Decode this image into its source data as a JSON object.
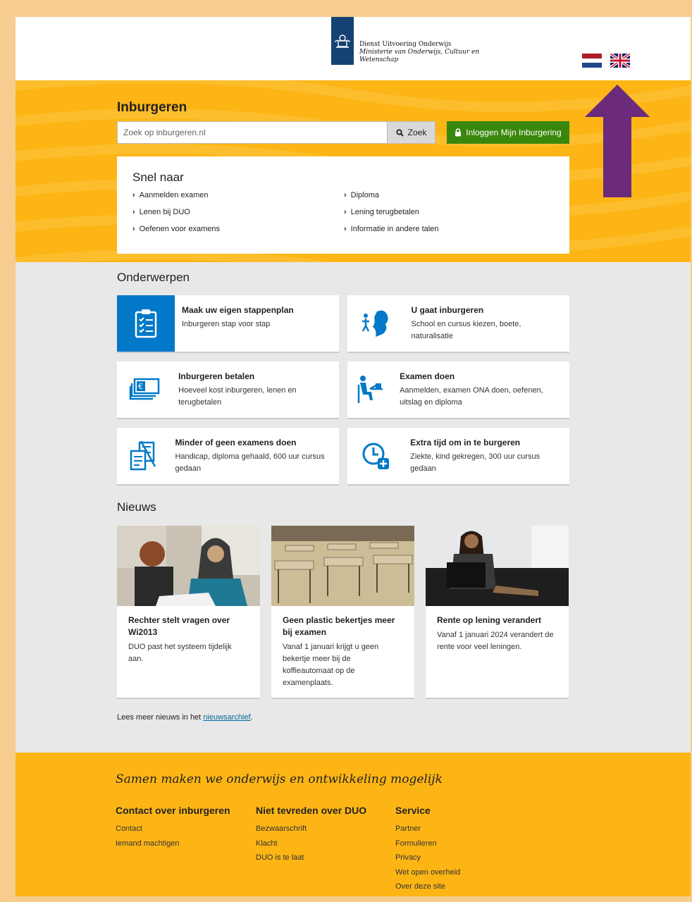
{
  "header": {
    "org_line1": "Dienst Uitvoering Onderwijs",
    "org_line2": "Ministerie van Onderwijs, Cultuur en",
    "org_line3": "Wetenschap"
  },
  "hero": {
    "title": "Inburgeren",
    "search_placeholder": "Zoek op inburgeren.nl",
    "search_button": "Zoek",
    "login_button": "Inloggen Mijn Inburgering"
  },
  "quick": {
    "title": "Snel naar",
    "items": [
      "Aanmelden examen",
      "Diploma",
      "Lenen bij DUO",
      "Lening terugbetalen",
      "Oefenen voor examens",
      "Informatie in andere talen"
    ]
  },
  "topics": {
    "title": "Onderwerpen",
    "cards": [
      {
        "title": "Maak uw eigen stappenplan",
        "desc": "Inburgeren stap voor stap",
        "icon": "clipboard-checklist-icon"
      },
      {
        "title": "U gaat inburgeren",
        "desc": "School en cursus kiezen, boete, naturalisatie",
        "icon": "netherlands-map-walker-icon"
      },
      {
        "title": "Inburgeren betalen",
        "desc": "Hoeveel kost inburgeren, lenen en terugbetalen",
        "icon": "euro-banknotes-icon"
      },
      {
        "title": "Examen doen",
        "desc": "Aanmelden, examen ONA doen, oefenen, uitslag en diploma",
        "icon": "person-at-desk-icon"
      },
      {
        "title": "Minder of geen examens doen",
        "desc": "Handicap, diploma gehaald, 600 uur cursus gedaan",
        "icon": "crossed-documents-icon"
      },
      {
        "title": "Extra tijd om in te burgeren",
        "desc": "Ziekte, kind gekregen, 300 uur cursus gedaan",
        "icon": "clock-plus-icon"
      }
    ]
  },
  "news": {
    "title": "Nieuws",
    "items": [
      {
        "title": "Rechter stelt vragen over Wi2013",
        "desc": "DUO past het systeem tijdelijk aan."
      },
      {
        "title": "Geen plastic bekertjes meer bij examen",
        "desc": "Vanaf 1 januari krijgt u geen bekertje meer bij de koffieautomaat op de examenplaats."
      },
      {
        "title": "Rente op lening verandert",
        "desc": "Vanaf 1 januari 2024 verandert de rente voor veel leningen."
      }
    ],
    "more_prefix": "Lees meer nieuws in het ",
    "more_link": "nieuwsarchief",
    "more_suffix": "."
  },
  "footer": {
    "slogan": "Samen maken we onderwijs en ontwikkeling mogelijk",
    "columns": [
      {
        "title": "Contact over inburgeren",
        "links": [
          "Contact",
          "Iemand machtigen"
        ]
      },
      {
        "title": "Niet tevreden over DUO",
        "links": [
          "Bezwaarschrift",
          "Klacht",
          "DUO is te laat"
        ]
      },
      {
        "title": "Service",
        "links": [
          "Partner",
          "Formulieren",
          "Privacy",
          "Wet open overheid",
          "Over deze site"
        ]
      }
    ]
  },
  "colors": {
    "hero_yellow": "#fdb515",
    "login_green": "#39870c",
    "icon_blue": "#0179c8",
    "logo_blue": "#154273",
    "arrow_purple": "#6b2a7a"
  }
}
